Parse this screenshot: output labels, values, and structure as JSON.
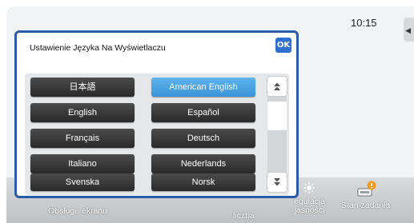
{
  "status": {
    "time": "10:15"
  },
  "taskbar": {
    "items": [
      {
        "label": "Obsługi",
        "icon": "help-icon"
      },
      {
        "label": "ekranu",
        "icon": "screen-icon"
      },
      {
        "label": "liczba",
        "icon": "count-icon"
      },
      {
        "label": "egulacja\njasności",
        "icon": "brightness-icon"
      },
      {
        "label": "Stan zadania",
        "icon": "job-status-icon"
      }
    ]
  },
  "dialog": {
    "title": "Ustawienie Języka Na Wyświetlaczu",
    "ok_label": "OK",
    "languages": [
      {
        "label": "日本語",
        "selected": false
      },
      {
        "label": "American English",
        "selected": true
      },
      {
        "label": "English",
        "selected": false
      },
      {
        "label": "Español",
        "selected": false
      },
      {
        "label": "Français",
        "selected": false
      },
      {
        "label": "Deutsch",
        "selected": false
      },
      {
        "label": "Italiano",
        "selected": false
      },
      {
        "label": "Nederlands",
        "selected": false
      },
      {
        "label": "Svenska",
        "selected": false
      },
      {
        "label": "Norsk",
        "selected": false
      }
    ]
  },
  "colors": {
    "dialog_border": "#2a5aa8",
    "ok_button": "#2f6fcf",
    "selected_language": "#3a94d6",
    "language_button": "#333333"
  }
}
